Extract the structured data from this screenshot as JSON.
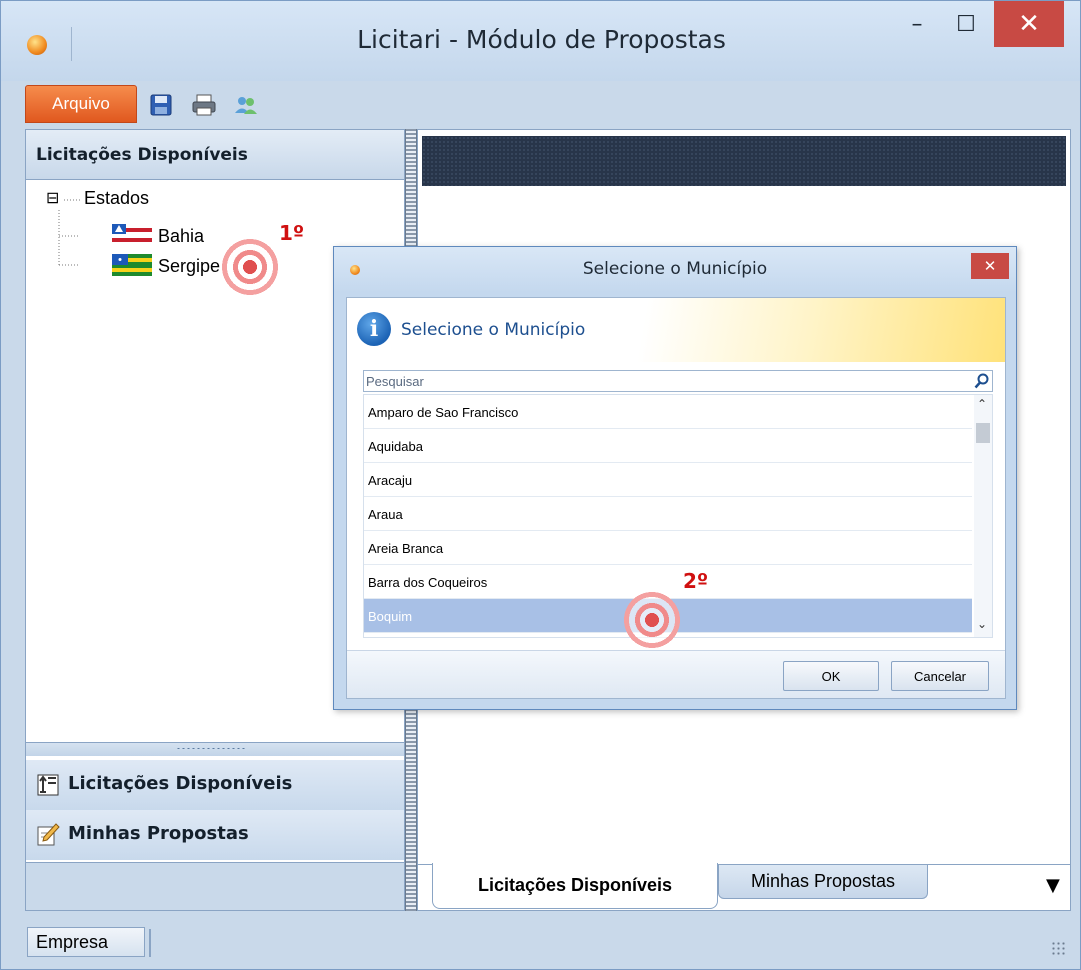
{
  "window": {
    "title": "Licitari - Módulo de Propostas",
    "minimize_glyph": "–",
    "maximize_glyph": "☐",
    "close_glyph": "✕"
  },
  "toolbar": {
    "menu_label": "Arquivo",
    "icons": [
      "save-icon",
      "print-icon",
      "users-icon"
    ]
  },
  "left_panel": {
    "header": "Licitações Disponíveis",
    "tree": {
      "expander": "⊟",
      "root": "Estados",
      "children": [
        "Bahia",
        "Sergipe"
      ]
    },
    "nav": [
      {
        "label": "Licitações Disponíveis",
        "icon": "list-icon"
      },
      {
        "label": "Minhas Propostas",
        "icon": "edit-icon"
      }
    ]
  },
  "right_panel": {
    "tabs": [
      {
        "label": "Licitações Disponíveis",
        "active": true
      },
      {
        "label": "Minhas Propostas",
        "active": false
      }
    ],
    "dropdown_glyph": "▼"
  },
  "statusbar": {
    "empresa": "Empresa"
  },
  "dialog": {
    "title": "Selecione o Município",
    "heading": "Selecione o Município",
    "close_glyph": "✕",
    "info_glyph": "i",
    "search_placeholder": "Pesquisar",
    "municipios": [
      "Amparo de Sao Francisco",
      "Aquidaba",
      "Aracaju",
      "Araua",
      "Areia Branca",
      "Barra dos Coqueiros",
      "Boquim"
    ],
    "selected": "Boquim",
    "scroll_up_glyph": "⌃",
    "scroll_down_glyph": "⌄",
    "ok_label": "OK",
    "cancel_label": "Cancelar"
  },
  "markers": {
    "first": "1º",
    "second": "2º"
  },
  "colors": {
    "accent_orange": "#e0581f",
    "selection_blue": "#a8c0e6",
    "close_red": "#c84a44",
    "marker_red": "#d01010"
  }
}
